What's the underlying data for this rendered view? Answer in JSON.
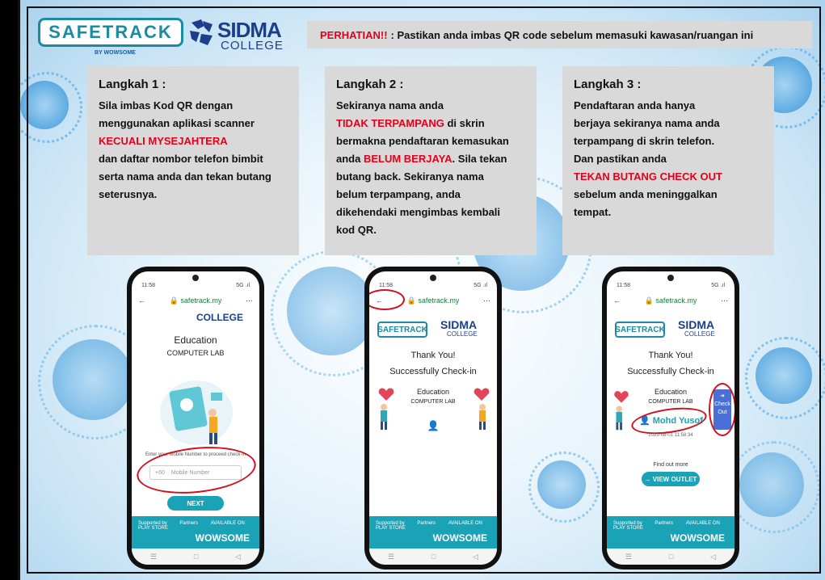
{
  "header": {
    "safetrack_logo": "SAFETRACK",
    "safetrack_by": "BY WOWSOME",
    "sidma_logo": "SIDMA",
    "sidma_sub": "COLLEGE",
    "notice_label": "PERHATIAN!!",
    "notice_text": ": Pastikan anda imbas QR code sebelum memasuki kawasan/ruangan ini"
  },
  "steps": [
    {
      "title": "Langkah 1 :",
      "line1": "Sila imbas Kod QR dengan",
      "line2": "menggunakan aplikasi scanner",
      "highlight": "KECUALI MYSEJAHTERA",
      "line3": "dan daftar nombor telefon bimbit",
      "line4": "serta nama anda dan tekan butang",
      "line5": "seterusnya."
    },
    {
      "title": "Langkah 2 :",
      "line1": "Sekiranya nama anda",
      "highlight1": "TIDAK TERPAMPANG",
      "line2": " di skrin",
      "line3": "bermakna pendaftaran kemasukan",
      "line4": "anda ",
      "highlight2": "BELUM BERJAYA",
      "line5": ". Sila tekan",
      "line6": "butang back. Sekiranya nama",
      "line7": "belum terpampang, anda",
      "line8": "dikehendaki mengimbas kembali",
      "line9": "kod QR."
    },
    {
      "title": "Langkah 3 :",
      "line1": "Pendaftaran anda hanya",
      "line2": "berjaya sekiranya nama anda",
      "line3": "terpampang di skrin telefon.",
      "line4": "Dan pastikan anda",
      "highlight": "TEKAN BUTANG CHECK OUT",
      "line5": "sebelum anda meninggalkan",
      "line6": "tempat."
    }
  ],
  "phones": {
    "status_time": "11:58",
    "status_signal": "5G .ıl",
    "url": "safetrack.my",
    "menu": "⋯",
    "back_arrow": "←",
    "phone1": {
      "logo_text": "COLLEGE",
      "location": "Education",
      "room": "COMPUTER LAB",
      "prompt": "Enter your Mobile Number to proceed check-in",
      "country_code": "+60",
      "placeholder": "Mobile Number",
      "next": "NEXT"
    },
    "phone2": {
      "logo_safetrack": "SAFETRACK",
      "logo_sidma": "SIDMA",
      "logo_college": "COLLEGE",
      "thanks": "Thank You!",
      "checkin": "Successfully Check-in",
      "location": "Education",
      "room": "COMPUTER LAB"
    },
    "phone3": {
      "logo_safetrack": "SAFETRACK",
      "logo_sidma": "SIDMA",
      "logo_college": "COLLEGE",
      "thanks": "Thank You!",
      "checkin": "Successfully Check-in",
      "location": "Education",
      "room": "COMPUTER LAB",
      "name": "Mohd Yusof",
      "datetime": "2021-08-01 11:58:34",
      "checkout_line1": "Check",
      "checkout_line2": "Out",
      "find_out": "Find out more",
      "view_outlet": "→ VIEW OUTLET"
    },
    "footer_brand": "WOWSOME",
    "footer_supported": "Supported by",
    "footer_partners": "Partners",
    "footer_available": "AVAILABLE ON PLAY STORE"
  },
  "colors": {
    "accent_red": "#e3001b",
    "teal": "#1aa2b6",
    "navy": "#1c3f8c",
    "panel_gray": "#d9d9d9"
  }
}
